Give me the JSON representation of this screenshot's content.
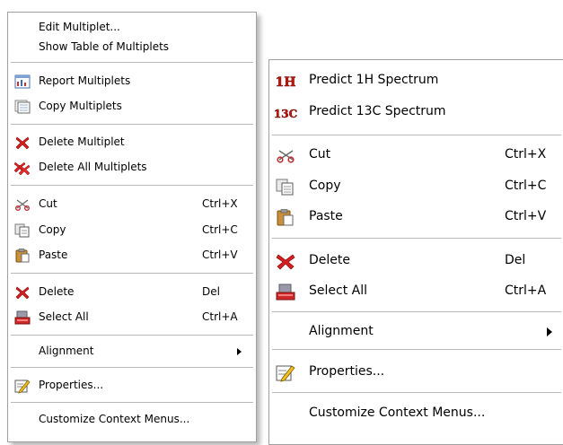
{
  "left_menu": {
    "edit_multiplet": "Edit Multiplet...",
    "show_table": "Show Table of Multiplets",
    "report_multiplets": "Report Multiplets",
    "copy_multiplets": "Copy Multiplets",
    "delete_multiplet": "Delete Multiplet",
    "delete_all_multiplets": "Delete All Multiplets",
    "cut": {
      "label": "Cut",
      "shortcut": "Ctrl+X"
    },
    "copy": {
      "label": "Copy",
      "shortcut": "Ctrl+C"
    },
    "paste": {
      "label": "Paste",
      "shortcut": "Ctrl+V"
    },
    "delete": {
      "label": "Delete",
      "shortcut": "Del"
    },
    "select_all": {
      "label": "Select All",
      "shortcut": "Ctrl+A"
    },
    "alignment": "Alignment",
    "properties": "Properties...",
    "customize": "Customize Context Menus..."
  },
  "right_menu": {
    "predict_1h": "Predict 1H Spectrum",
    "predict_13c": "Predict 13C Spectrum",
    "cut": {
      "label": "Cut",
      "shortcut": "Ctrl+X"
    },
    "copy": {
      "label": "Copy",
      "shortcut": "Ctrl+C"
    },
    "paste": {
      "label": "Paste",
      "shortcut": "Ctrl+V"
    },
    "delete": {
      "label": "Delete",
      "shortcut": "Del"
    },
    "select_all": {
      "label": "Select All",
      "shortcut": "Ctrl+A"
    },
    "alignment": "Alignment",
    "properties": "Properties...",
    "customize": "Customize Context Menus..."
  },
  "icon_text": {
    "predict_1h": "1H",
    "predict_13c": "13C"
  },
  "colors": {
    "delete_red": "#d42020",
    "predict_red": "#c8140a",
    "separator": "#b8b8b8",
    "menu_border": "#a0a0a0"
  }
}
